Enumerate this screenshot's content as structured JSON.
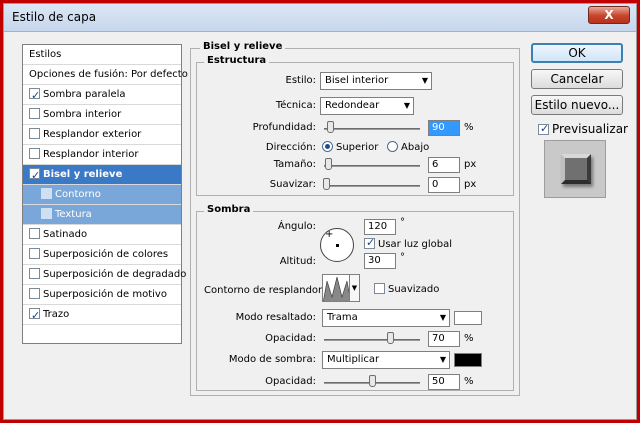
{
  "window": {
    "title": "Estilo de capa",
    "close_label": "X"
  },
  "styles_panel": {
    "header": "Estilos",
    "blend_options": "Opciones de fusión: Por defecto",
    "items": [
      {
        "label": "Sombra paralela",
        "checked": true
      },
      {
        "label": "Sombra interior",
        "checked": false
      },
      {
        "label": "Resplandor exterior",
        "checked": false
      },
      {
        "label": "Resplandor interior",
        "checked": false
      },
      {
        "label": "Bisel y relieve",
        "checked": true
      },
      {
        "label": "Contorno",
        "checked": false
      },
      {
        "label": "Textura",
        "checked": false
      },
      {
        "label": "Satinado",
        "checked": false
      },
      {
        "label": "Superposición de colores",
        "checked": false
      },
      {
        "label": "Superposición de degradado",
        "checked": false
      },
      {
        "label": "Superposición de motivo",
        "checked": false
      },
      {
        "label": "Trazo",
        "checked": true
      }
    ]
  },
  "bevel": {
    "section_title": "Bisel y relieve",
    "structure": {
      "title": "Estructura",
      "style_label": "Estilo:",
      "style_value": "Bisel interior",
      "technique_label": "Técnica:",
      "technique_value": "Redondear",
      "depth_label": "Profundidad:",
      "depth_value": "90",
      "depth_unit": "%",
      "direction_label": "Dirección:",
      "direction_up": "Superior",
      "direction_down": "Abajo",
      "size_label": "Tamaño:",
      "size_value": "6",
      "size_unit": "px",
      "soften_label": "Suavizar:",
      "soften_value": "0",
      "soften_unit": "px"
    },
    "shading": {
      "title": "Sombra",
      "angle_label": "Ángulo:",
      "angle_value": "120",
      "angle_unit": "°",
      "global_light_label": "Usar luz global",
      "altitude_label": "Altitud:",
      "altitude_value": "30",
      "altitude_unit": "°",
      "gloss_contour_label": "Contorno de resplandor:",
      "antialias_label": "Suavizado",
      "highlight_mode_label": "Modo resaltado:",
      "highlight_mode_value": "Trama",
      "highlight_color": "#ffffff",
      "highlight_opacity_label": "Opacidad:",
      "highlight_opacity_value": "70",
      "highlight_opacity_unit": "%",
      "shadow_mode_label": "Modo de sombra:",
      "shadow_mode_value": "Multiplicar",
      "shadow_color": "#000000",
      "shadow_opacity_label": "Opacidad:",
      "shadow_opacity_value": "50",
      "shadow_opacity_unit": "%"
    }
  },
  "buttons": {
    "ok": "OK",
    "cancel": "Cancelar",
    "new_style": "Estilo nuevo...",
    "preview": "Previsualizar"
  },
  "accent_color": "#3a79c5"
}
